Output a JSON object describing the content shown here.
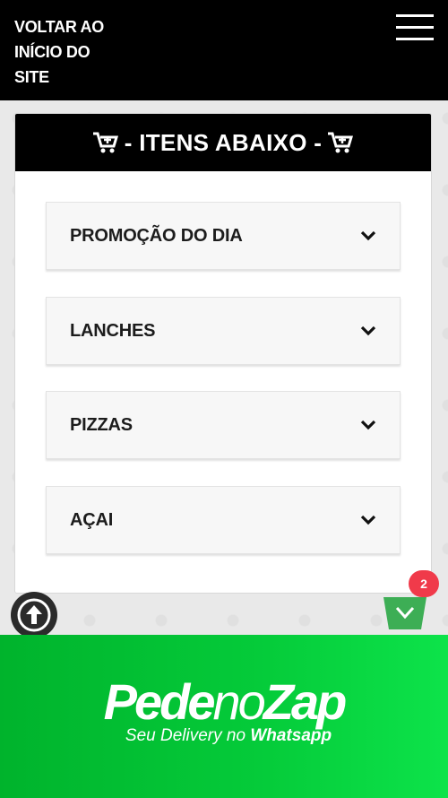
{
  "topbar": {
    "back_label": "VOLTAR AO INÍCIO DO SITE",
    "menu_icon": "hamburger-menu-icon"
  },
  "items_card": {
    "title": "- ITENS ABAIXO -",
    "title_icon": "shopping-cart-icon",
    "categories": [
      {
        "label": "PROMOÇÃO DO DIA",
        "icon": "chevron-down-icon"
      },
      {
        "label": "LANCHES",
        "icon": "chevron-down-icon"
      },
      {
        "label": "PIZZAS",
        "icon": "chevron-down-icon"
      },
      {
        "label": "AÇAI",
        "icon": "chevron-down-icon"
      }
    ]
  },
  "floating": {
    "scroll_top_icon": "arrow-up-icon",
    "basket_icon": "shopping-basket-icon",
    "basket_count": "2"
  },
  "footer": {
    "brand_part1": "Pede",
    "brand_part2": "no",
    "brand_part3": "Zap",
    "tagline_prefix": "Seu Delivery no ",
    "tagline_bold": "Whatsapp"
  },
  "colors": {
    "topbar": "#000000",
    "footer_green": "#05cc3a",
    "badge_red": "#f03a4a",
    "basket_green": "#3dae55"
  }
}
